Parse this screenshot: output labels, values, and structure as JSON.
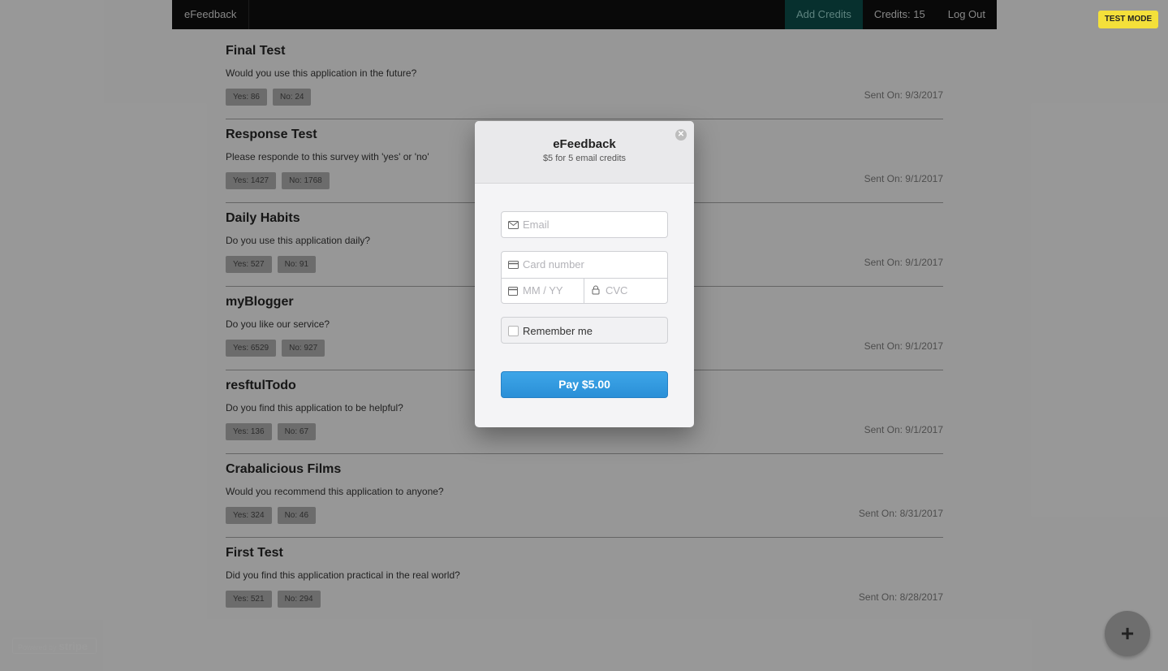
{
  "navbar": {
    "brand": "eFeedback",
    "add_credits": "Add Credits",
    "credits": "Credits: 15",
    "logout": "Log Out"
  },
  "test_mode": "TEST MODE",
  "surveys": [
    {
      "title": "Final Test",
      "question": "Would you use this application in the future?",
      "yes": "Yes: 86",
      "no": "No: 24",
      "sent": "Sent On: 9/3/2017"
    },
    {
      "title": "Response Test",
      "question": "Please responde to this survey with 'yes' or 'no'",
      "yes": "Yes: 1427",
      "no": "No: 1768",
      "sent": "Sent On: 9/1/2017"
    },
    {
      "title": "Daily Habits",
      "question": "Do you use this application daily?",
      "yes": "Yes: 527",
      "no": "No: 91",
      "sent": "Sent On: 9/1/2017"
    },
    {
      "title": "myBlogger",
      "question": "Do you like our service?",
      "yes": "Yes: 6529",
      "no": "No: 927",
      "sent": "Sent On: 9/1/2017"
    },
    {
      "title": "resftulTodo",
      "question": "Do you find this application to be helpful?",
      "yes": "Yes: 136",
      "no": "No: 67",
      "sent": "Sent On: 9/1/2017"
    },
    {
      "title": "Crabalicious Films",
      "question": "Would you recommend this application to anyone?",
      "yes": "Yes: 324",
      "no": "No: 46",
      "sent": "Sent On: 8/31/2017"
    },
    {
      "title": "First Test",
      "question": "Did you find this application practical in the real world?",
      "yes": "Yes: 521",
      "no": "No: 294",
      "sent": "Sent On: 8/28/2017"
    }
  ],
  "powered_by": {
    "prefix": "Powered by",
    "brand": "stripe"
  },
  "fab_icon": "plus-icon",
  "modal": {
    "title": "eFeedback",
    "subtitle": "$5 for 5 email credits",
    "email_placeholder": "Email",
    "card_placeholder": "Card number",
    "expiry_placeholder": "MM / YY",
    "cvc_placeholder": "CVC",
    "remember_label": "Remember me",
    "pay_label": "Pay $5.00"
  },
  "colors": {
    "pay_button": "#2a8fd7",
    "test_mode": "#f4e03a",
    "active_nav": "#0c4a47"
  }
}
